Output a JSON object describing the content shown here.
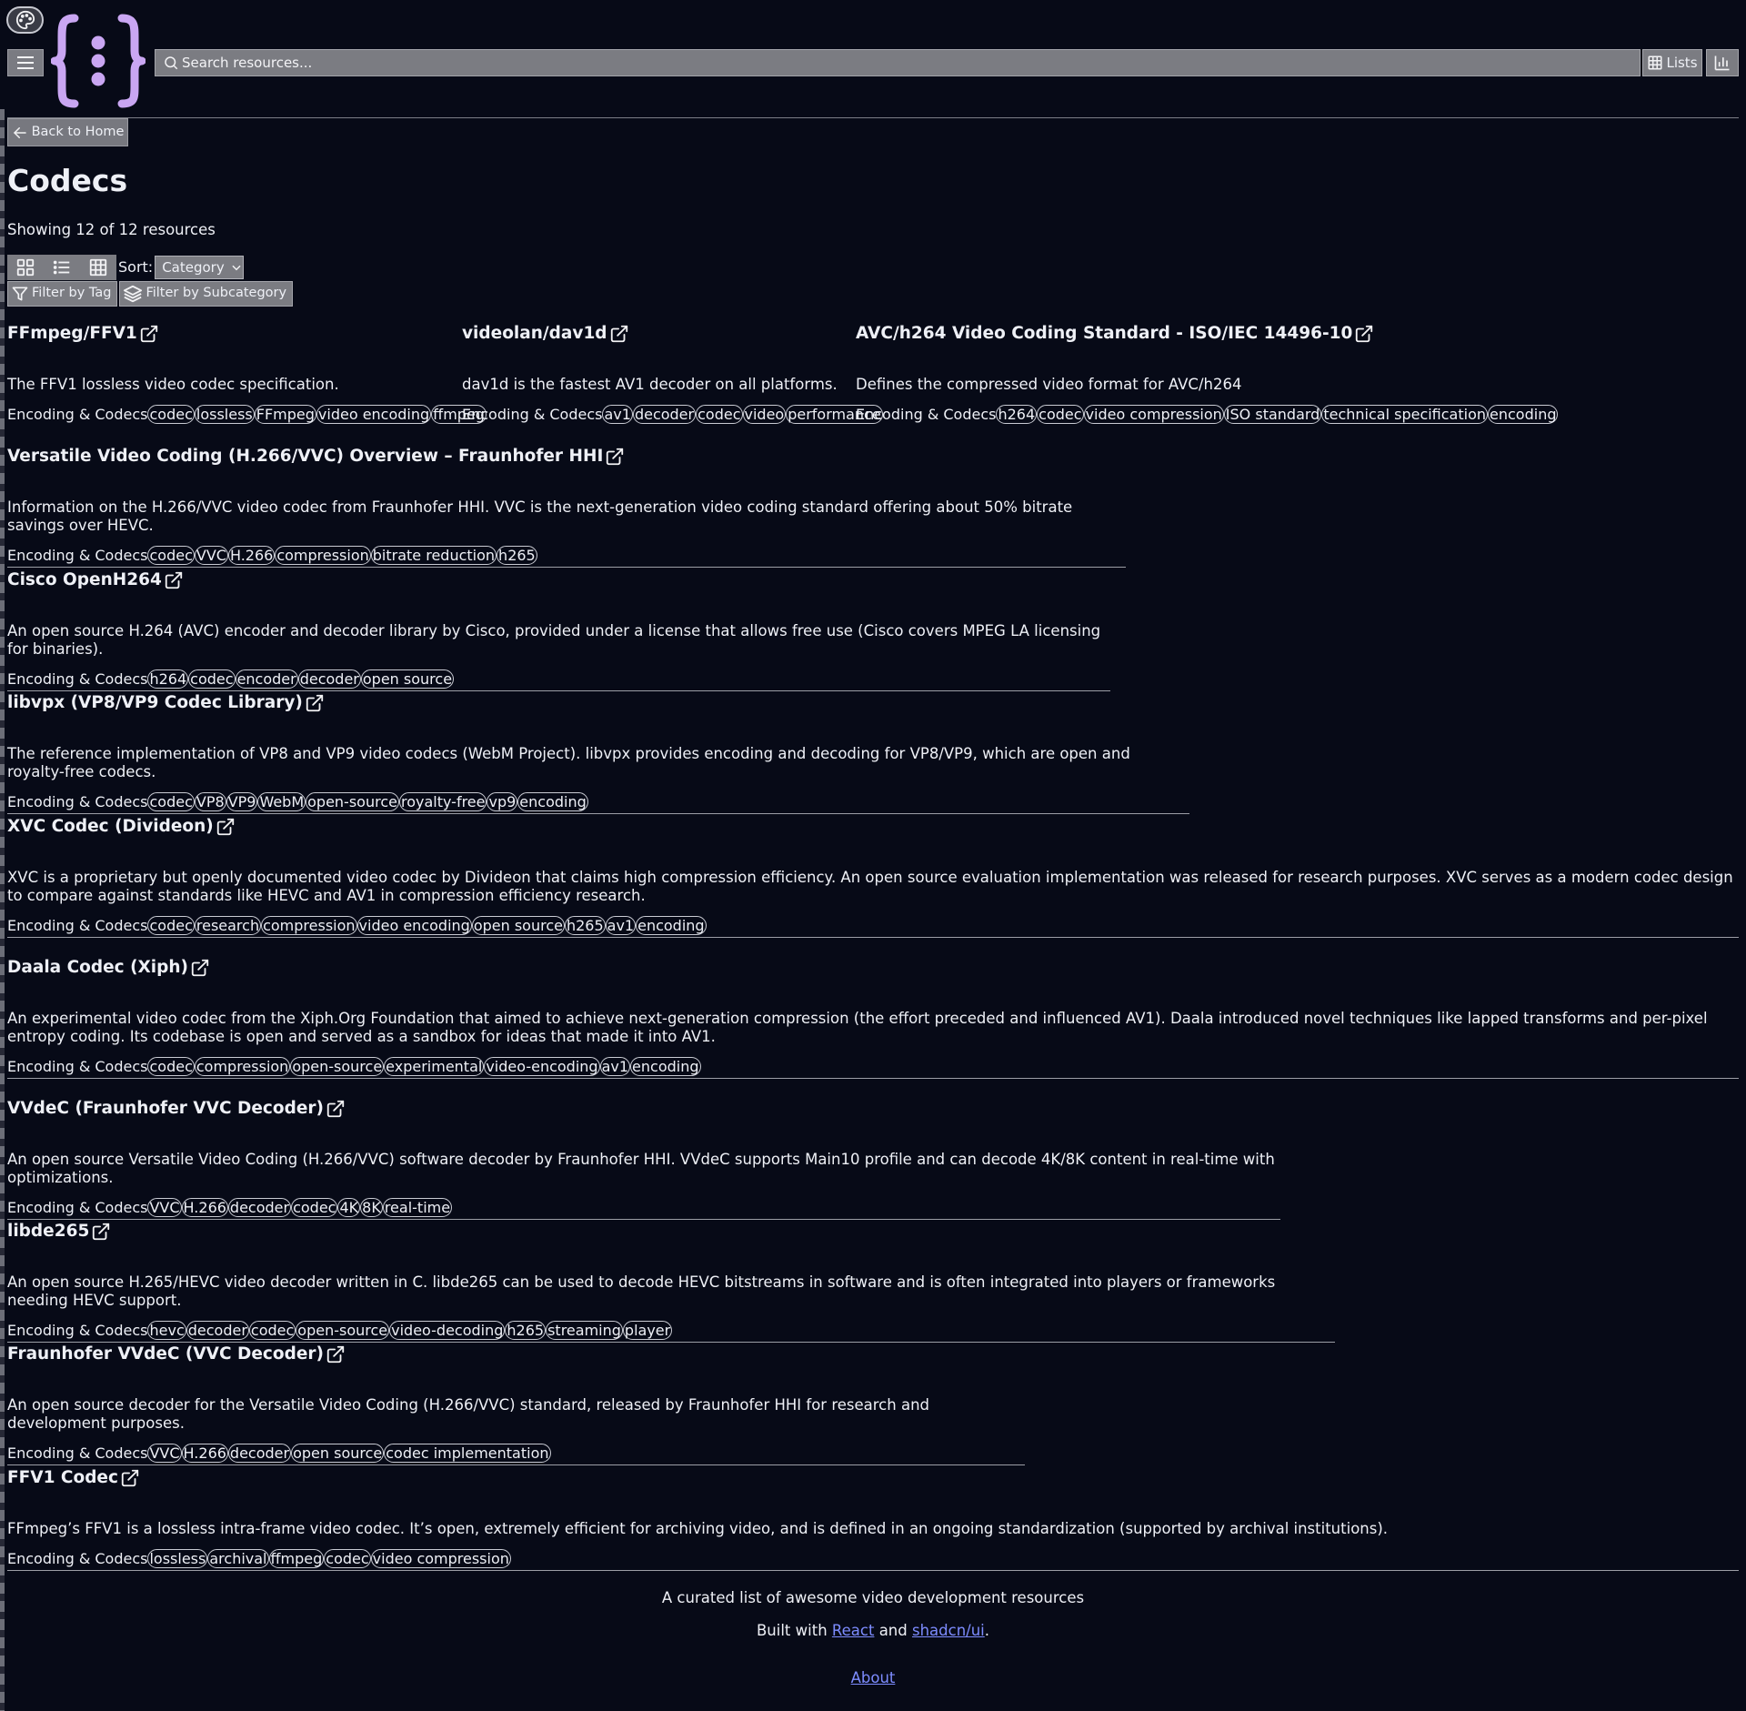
{
  "header": {
    "search_placeholder": "Search resources...",
    "lists_label": "Lists"
  },
  "nav": {
    "back_label": "Back to Home"
  },
  "page": {
    "title": "Codecs",
    "count_text": "Showing 12 of 12 resources",
    "sort_label": "Sort:",
    "sort_value": "Category",
    "filter_tag_label": "Filter by Tag",
    "filter_subcategory_label": "Filter by Subcategory"
  },
  "resources": [
    {
      "title": "FFmpeg/FFV1",
      "desc": "The FFV1 lossless video codec specification.",
      "category": "Encoding & Codecs",
      "tags": [
        "codec",
        "lossless",
        "FFmpeg",
        "video encoding",
        "ffmpeg"
      ]
    },
    {
      "title": "videolan/dav1d",
      "desc": "dav1d is the fastest AV1 decoder on all platforms.",
      "category": "Encoding & Codecs",
      "tags": [
        "av1",
        "decoder",
        "codec",
        "video",
        "performance"
      ]
    },
    {
      "title": "AVC/h264 Video Coding Standard - ISO/IEC 14496-10",
      "desc": "Defines the compressed video format for AVC/h264",
      "category": "Encoding & Codecs",
      "tags": [
        "h264",
        "codec",
        "video compression",
        "ISO standard",
        "technical specification",
        "encoding"
      ]
    },
    {
      "title": "Versatile Video Coding (H.266/VVC) Overview – Fraunhofer HHI",
      "desc": "Information on the H.266/VVC video codec from Fraunhofer HHI. VVC is the next-generation video coding standard offering about 50% bitrate savings over HEVC.",
      "category": "Encoding & Codecs",
      "tags": [
        "codec",
        "VVC",
        "H.266",
        "compression",
        "bitrate reduction",
        "h265"
      ]
    },
    {
      "title": "Cisco OpenH264",
      "desc": "An open source H.264 (AVC) encoder and decoder library by Cisco, provided under a license that allows free use (Cisco covers MPEG LA licensing for binaries).",
      "category": "Encoding & Codecs",
      "tags": [
        "h264",
        "codec",
        "encoder",
        "decoder",
        "open source"
      ]
    },
    {
      "title": "libvpx (VP8/VP9 Codec Library)",
      "desc": "The reference implementation of VP8 and VP9 video codecs (WebM Project). libvpx provides encoding and decoding for VP8/VP9, which are open and royalty-free codecs.",
      "category": "Encoding & Codecs",
      "tags": [
        "codec",
        "VP8",
        "VP9",
        "WebM",
        "open-source",
        "royalty-free",
        "vp9",
        "encoding"
      ]
    },
    {
      "title": "XVC Codec (Divideon)",
      "desc": "XVC is a proprietary but openly documented video codec by Divideon that claims high compression efficiency. An open source evaluation implementation was released for research purposes. XVC serves as a modern codec design to compare against standards like HEVC and AV1 in compression efficiency research.",
      "category": "Encoding & Codecs",
      "tags": [
        "codec",
        "research",
        "compression",
        "video encoding",
        "open source",
        "h265",
        "av1",
        "encoding"
      ]
    },
    {
      "title": "Daala Codec (Xiph)",
      "desc": "An experimental video codec from the Xiph.Org Foundation that aimed to achieve next-generation compression (the effort preceded and influenced AV1). Daala introduced novel techniques like lapped transforms and per-pixel entropy coding. Its codebase is open and served as a sandbox for ideas that made it into AV1.",
      "category": "Encoding & Codecs",
      "tags": [
        "codec",
        "compression",
        "open-source",
        "experimental",
        "video-encoding",
        "av1",
        "encoding"
      ]
    },
    {
      "title": "VVdeC (Fraunhofer VVC Decoder)",
      "desc": "An open source Versatile Video Coding (H.266/VVC) software decoder by Fraunhofer HHI. VVdeC supports Main10 profile and can decode 4K/8K content in real-time with optimizations.",
      "category": "Encoding & Codecs",
      "tags": [
        "VVC",
        "H.266",
        "decoder",
        "codec",
        "4K",
        "8K",
        "real-time"
      ]
    },
    {
      "title": "libde265",
      "desc": "An open source H.265/HEVC video decoder written in C. libde265 can be used to decode HEVC bitstreams in software and is often integrated into players or frameworks needing HEVC support.",
      "category": "Encoding & Codecs",
      "tags": [
        "hevc",
        "decoder",
        "codec",
        "open-source",
        "video-decoding",
        "h265",
        "streaming",
        "player"
      ]
    },
    {
      "title": "Fraunhofer VVdeC (VVC Decoder)",
      "desc": "An open source decoder for the Versatile Video Coding (H.266/VVC) standard, released by Fraunhofer HHI for research and development purposes.",
      "category": "Encoding & Codecs",
      "tags": [
        "VVC",
        "H.266",
        "decoder",
        "open source",
        "codec implementation"
      ]
    },
    {
      "title": "FFV1 Codec",
      "desc": "FFmpeg’s FFV1 is a lossless intra-frame video codec. It’s open, extremely efficient for archiving video, and is defined in an ongoing standardization (supported by archival institutions).",
      "category": "Encoding & Codecs",
      "tags": [
        "lossless",
        "archival",
        "ffmpeg",
        "codec",
        "video compression"
      ]
    }
  ],
  "footer": {
    "tagline": "A curated list of awesome video development resources",
    "built_prefix": "Built with",
    "react_link": "React",
    "and_text": "and",
    "shadcn_link": "shadcn/ui",
    "period": ".",
    "about_link": "About"
  },
  "colors": {
    "background": "#070a17",
    "link": "#7d8cff",
    "logo": "#c9a6f2",
    "button": "#7b7c82"
  }
}
